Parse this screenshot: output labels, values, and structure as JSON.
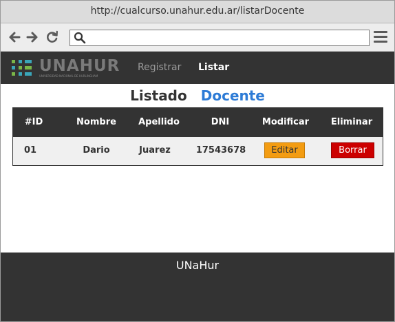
{
  "browser": {
    "url": "http://cualcurso.unahur.edu.ar/listarDocente",
    "search_placeholder": ""
  },
  "navbar": {
    "logo_text": "UNAHUR",
    "logo_subtext": "UNIVERSIDAD NACIONAL DE HURLINGHAM",
    "links": [
      {
        "label": "Registrar"
      },
      {
        "label": "Listar"
      }
    ]
  },
  "page": {
    "heading_part1": "Listado",
    "heading_part2": "Docente"
  },
  "table": {
    "headers": [
      "#ID",
      "Nombre",
      "Apellido",
      "DNI",
      "Modificar",
      "Eliminar"
    ],
    "rows": [
      {
        "id": "01",
        "nombre": "Dario",
        "apellido": "Juarez",
        "dni": "17543678",
        "edit_label": "Editar",
        "delete_label": "Borrar"
      }
    ]
  },
  "footer": {
    "text": "UNaHur"
  },
  "colors": {
    "navbar_bg": "#333333",
    "heading_accent": "#2d7bd6",
    "edit_button": "#f39c12",
    "delete_button": "#cc0000",
    "logo_green": "#7ab648",
    "logo_teal": "#3aa6b9"
  }
}
